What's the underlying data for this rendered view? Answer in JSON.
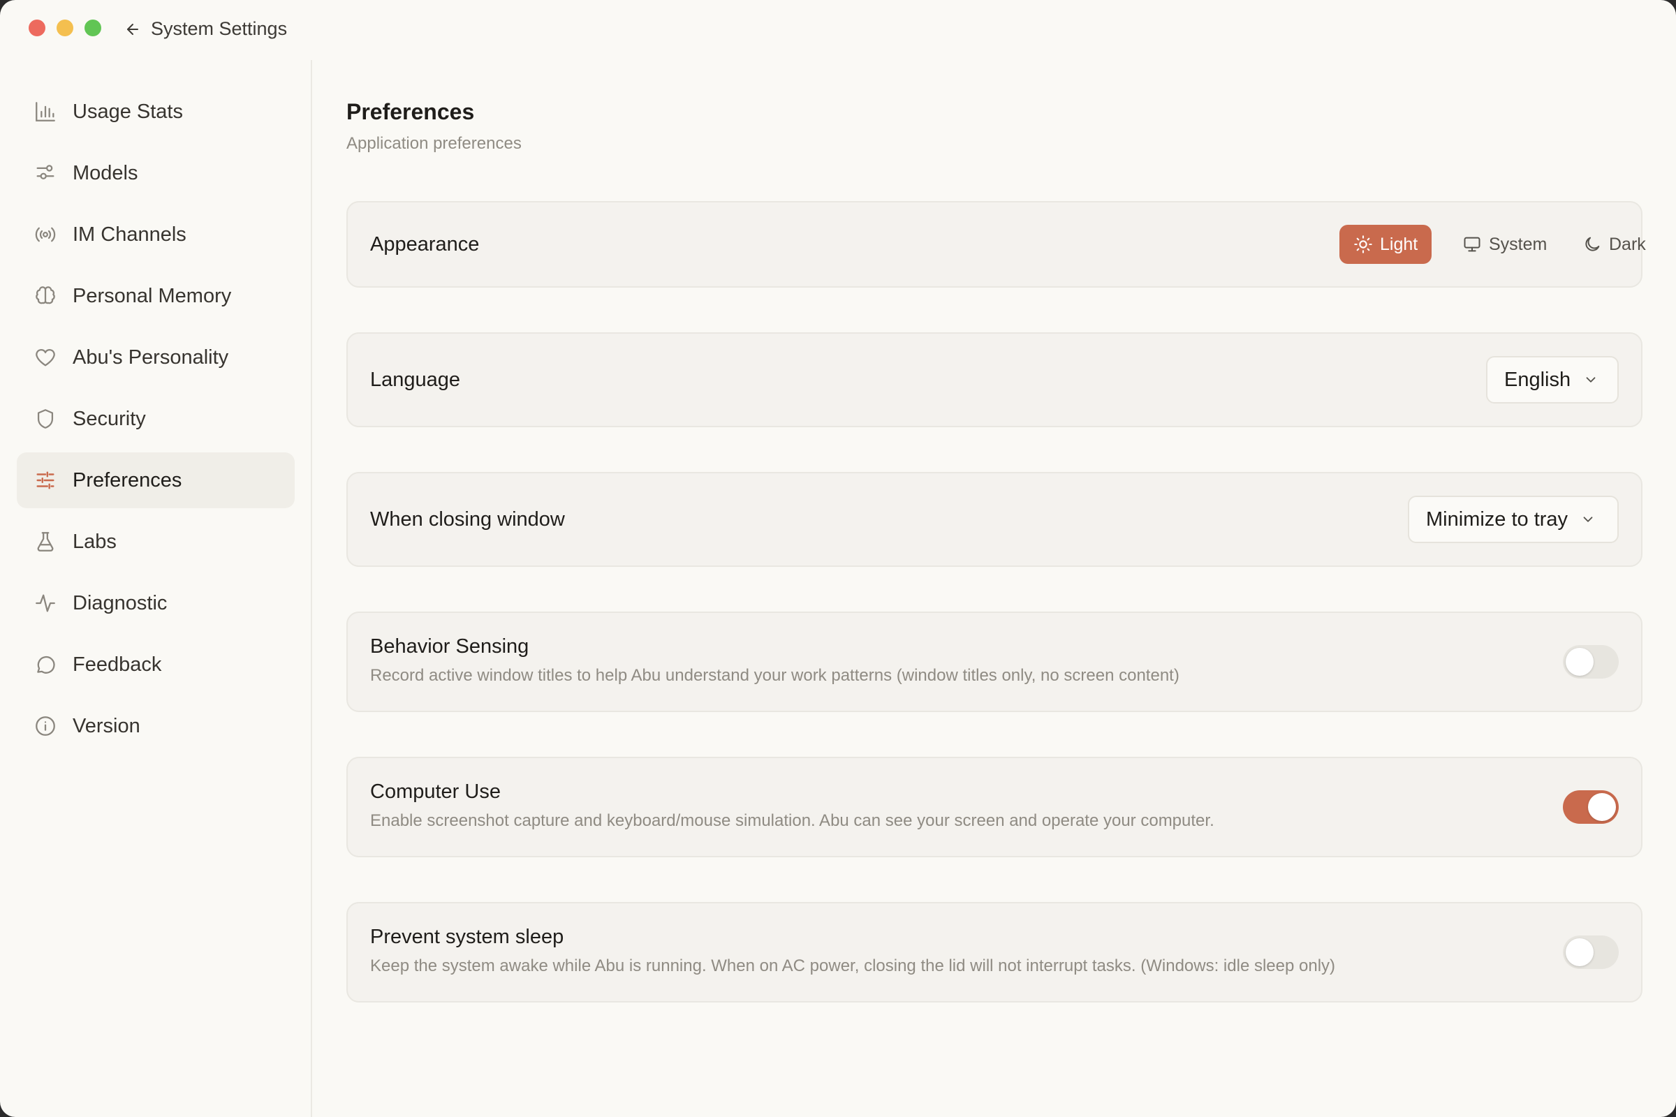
{
  "titlebar": {
    "back_label": "System Settings"
  },
  "sidebar": {
    "items": [
      {
        "label": "Usage Stats",
        "icon": "bar-chart-icon"
      },
      {
        "label": "Models",
        "icon": "sliders-icon"
      },
      {
        "label": "IM Channels",
        "icon": "broadcast-icon"
      },
      {
        "label": "Personal Memory",
        "icon": "brain-icon"
      },
      {
        "label": "Abu's Personality",
        "icon": "heart-icon"
      },
      {
        "label": "Security",
        "icon": "shield-icon"
      },
      {
        "label": "Preferences",
        "icon": "settings-sliders-icon",
        "active": true
      },
      {
        "label": "Labs",
        "icon": "flask-icon"
      },
      {
        "label": "Diagnostic",
        "icon": "activity-icon"
      },
      {
        "label": "Feedback",
        "icon": "message-circle-icon"
      },
      {
        "label": "Version",
        "icon": "info-icon"
      }
    ]
  },
  "main": {
    "title": "Preferences",
    "subtitle": "Application preferences",
    "appearance": {
      "label": "Appearance",
      "options": [
        {
          "label": "Light",
          "icon": "sun-icon",
          "selected": true
        },
        {
          "label": "System",
          "icon": "monitor-icon",
          "selected": false
        },
        {
          "label": "Dark",
          "icon": "moon-icon",
          "selected": false
        }
      ]
    },
    "language": {
      "label": "Language",
      "value": "English"
    },
    "closing": {
      "label": "When closing window",
      "value": "Minimize to tray"
    },
    "behavior_sensing": {
      "label": "Behavior Sensing",
      "description": "Record active window titles to help Abu understand your work patterns (window titles only, no screen content)",
      "enabled": false
    },
    "computer_use": {
      "label": "Computer Use",
      "description": "Enable screenshot capture and keyboard/mouse simulation. Abu can see your screen and operate your computer.",
      "enabled": true
    },
    "prevent_sleep": {
      "label": "Prevent system sleep",
      "description": "Keep the system awake while Abu is running. When on AC power, closing the lid will not interrupt tasks. (Windows: idle sleep only)",
      "enabled": false
    }
  },
  "colors": {
    "accent": "#c96a4d",
    "background": "#faf9f5",
    "card": "#f4f2ee"
  }
}
